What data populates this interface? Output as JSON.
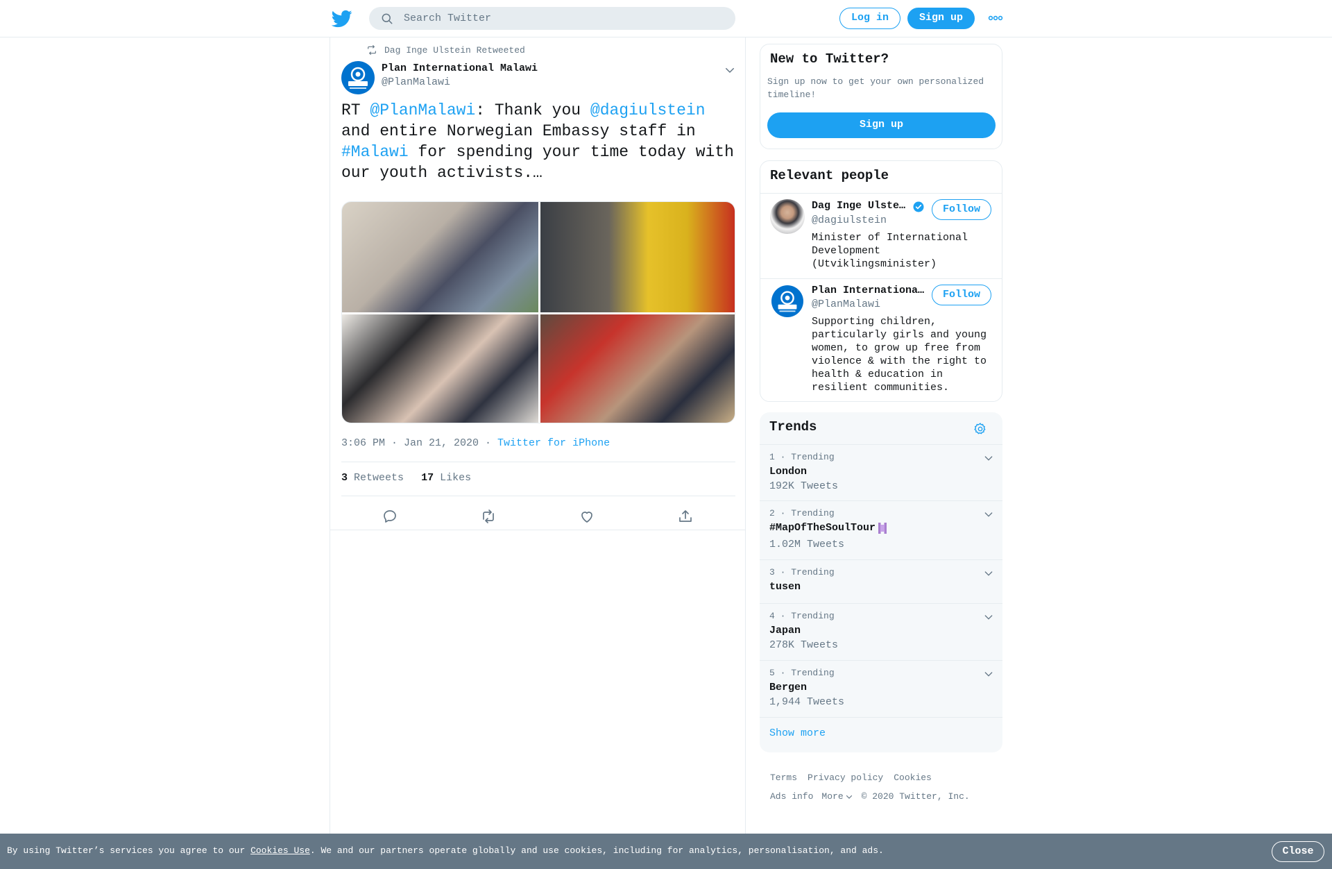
{
  "header": {
    "search_placeholder": "Search Twitter",
    "login_label": "Log in",
    "signup_label": "Sign up"
  },
  "tweet": {
    "retweeted_by": "Dag Inge Ulstein Retweeted",
    "author_name": "Plan International Malawi",
    "author_handle": "@PlanMalawi",
    "text_parts": [
      "RT ",
      "@PlanMalawi",
      ": Thank you ",
      "@dagiulstein",
      " and entire Norwegian Embassy staff in ",
      "#Malawi",
      " for spending your time today with our youth activists.…"
    ],
    "timestamp": "3:06 PM · Jan 21, 2020 · ",
    "source": "Twitter for iPhone",
    "retweets_count": "3",
    "retweets_label": "Retweets",
    "likes_count": "17",
    "likes_label": "Likes"
  },
  "new_to_twitter": {
    "title": "New to Twitter?",
    "text": "Sign up now to get your own personalized timeline!",
    "button": "Sign up"
  },
  "relevant_people": {
    "title": "Relevant people",
    "people": [
      {
        "name": "Dag Inge Ulste…",
        "handle": "@dagiulstein",
        "bio": "Minister of International Development (Utviklingsminister)",
        "follow": "Follow"
      },
      {
        "name": "Plan Internationa…",
        "handle": "@PlanMalawi",
        "bio": "Supporting children, particularly girls and young women, to grow up free from violence & with the right to health & education in resilient communities.",
        "follow": "Follow"
      }
    ]
  },
  "trends": {
    "title": "Trends",
    "items": [
      {
        "meta": "1 · Trending",
        "name": "London",
        "count": "192K Tweets"
      },
      {
        "meta": "2 · Trending",
        "name": "#MapOfTheSoulTour",
        "count": "1.02M Tweets"
      },
      {
        "meta": "3 · Trending",
        "name": "tusen",
        "count": ""
      },
      {
        "meta": "4 · Trending",
        "name": "Japan",
        "count": "278K Tweets"
      },
      {
        "meta": "5 · Trending",
        "name": "Bergen",
        "count": "1,944 Tweets"
      }
    ],
    "show_more": "Show more"
  },
  "footer": {
    "links_row1": [
      "Terms",
      "Privacy policy",
      "Cookies"
    ],
    "ads_info": "Ads info",
    "more": "More",
    "copyright": "© 2020 Twitter, Inc."
  },
  "cookie_bar": {
    "text_before": "By using Twitter’s services you agree to our ",
    "link": "Cookies Use",
    "text_after": ". We and our partners operate globally and use cookies, including for analytics, personalisation, and ads.",
    "close": "Close"
  },
  "colors": {
    "accent": "#1da1f2",
    "text_primary": "#14171a",
    "text_secondary": "#657786",
    "border": "#e6ecf0"
  }
}
